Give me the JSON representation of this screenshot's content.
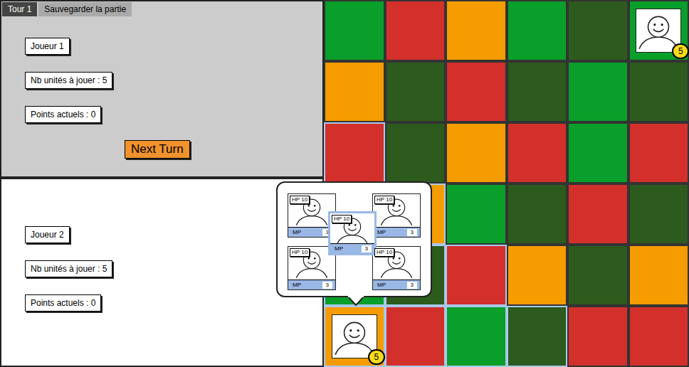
{
  "header": {
    "tabs": [
      {
        "label": "Tour 1",
        "selected": true
      },
      {
        "label": "Sauvegarder la partie",
        "selected": false
      }
    ]
  },
  "players": [
    {
      "name": "Joueur 1",
      "units_label": "Nb unités à jouer : 5",
      "points_label": "Points actuels : 0",
      "active": true
    },
    {
      "name": "Joueur 2",
      "units_label": "Nb unités à jouer : 5",
      "points_label": "Points actuels : 0",
      "active": false
    }
  ],
  "next_turn_button": "Next Turn",
  "board": {
    "rows": [
      [
        {
          "color": "#0a9e2a",
          "highlighted": false,
          "unit_count": null
        },
        {
          "color": "#d3302c",
          "highlighted": false,
          "unit_count": null
        },
        {
          "color": "#f59c00",
          "highlighted": false,
          "unit_count": null
        },
        {
          "color": "#0a9e2a",
          "highlighted": false,
          "unit_count": null
        },
        {
          "color": "#2d5a1d",
          "highlighted": false,
          "unit_count": null
        },
        {
          "color": "#0a9e2a",
          "highlighted": false,
          "unit_count": "5"
        }
      ],
      [
        {
          "color": "#f59c00",
          "highlighted": false,
          "unit_count": null
        },
        {
          "color": "#2d5a1d",
          "highlighted": false,
          "unit_count": null
        },
        {
          "color": "#d3302c",
          "highlighted": false,
          "unit_count": null
        },
        {
          "color": "#2d5a1d",
          "highlighted": false,
          "unit_count": null
        },
        {
          "color": "#0a9e2a",
          "highlighted": false,
          "unit_count": null
        },
        {
          "color": "#2d5a1d",
          "highlighted": false,
          "unit_count": null
        }
      ],
      [
        {
          "color": "#d3302c",
          "highlighted": true,
          "unit_count": null
        },
        {
          "color": "#2d5a1d",
          "highlighted": false,
          "unit_count": null
        },
        {
          "color": "#f59c00",
          "highlighted": false,
          "unit_count": null
        },
        {
          "color": "#d3302c",
          "highlighted": false,
          "unit_count": null
        },
        {
          "color": "#0a9e2a",
          "highlighted": false,
          "unit_count": null
        },
        {
          "color": "#d3302c",
          "highlighted": false,
          "unit_count": null
        }
      ],
      [
        {
          "color": "#d3302c",
          "highlighted": true,
          "unit_count": null
        },
        {
          "color": "#f59c00",
          "highlighted": true,
          "unit_count": null
        },
        {
          "color": "#0a9e2a",
          "highlighted": false,
          "unit_count": null
        },
        {
          "color": "#2d5a1d",
          "highlighted": false,
          "unit_count": null
        },
        {
          "color": "#d3302c",
          "highlighted": false,
          "unit_count": null
        },
        {
          "color": "#2d5a1d",
          "highlighted": false,
          "unit_count": null
        }
      ],
      [
        {
          "color": "#0a9e2a",
          "highlighted": true,
          "unit_count": null
        },
        {
          "color": "#2d5a1d",
          "highlighted": true,
          "unit_count": null
        },
        {
          "color": "#d3302c",
          "highlighted": true,
          "unit_count": null
        },
        {
          "color": "#f59c00",
          "highlighted": false,
          "unit_count": null
        },
        {
          "color": "#2d5a1d",
          "highlighted": false,
          "unit_count": null
        },
        {
          "color": "#f59c00",
          "highlighted": false,
          "unit_count": null
        }
      ],
      [
        {
          "color": "#f59c00",
          "highlighted": true,
          "unit_count": "5"
        },
        {
          "color": "#d3302c",
          "highlighted": true,
          "unit_count": null
        },
        {
          "color": "#0a9e2a",
          "highlighted": true,
          "unit_count": null
        },
        {
          "color": "#2d5a1d",
          "highlighted": true,
          "unit_count": null
        },
        {
          "color": "#d3302c",
          "highlighted": false,
          "unit_count": null
        },
        {
          "color": "#d3302c",
          "highlighted": false,
          "unit_count": null
        }
      ]
    ]
  },
  "unit_popup": {
    "units": [
      {
        "hp": "HP 10",
        "mp_label": "MP",
        "mp": "3",
        "selected": false
      },
      {
        "hp": "HP 10",
        "mp_label": "MP",
        "mp": "3",
        "selected": false
      },
      {
        "hp": "HP 10",
        "mp_label": "MP",
        "mp": "3",
        "selected": true
      },
      {
        "hp": "HP 10",
        "mp_label": "MP",
        "mp": "3",
        "selected": false
      },
      {
        "hp": "HP 10",
        "mp_label": "MP",
        "mp": "3",
        "selected": false
      }
    ]
  }
}
